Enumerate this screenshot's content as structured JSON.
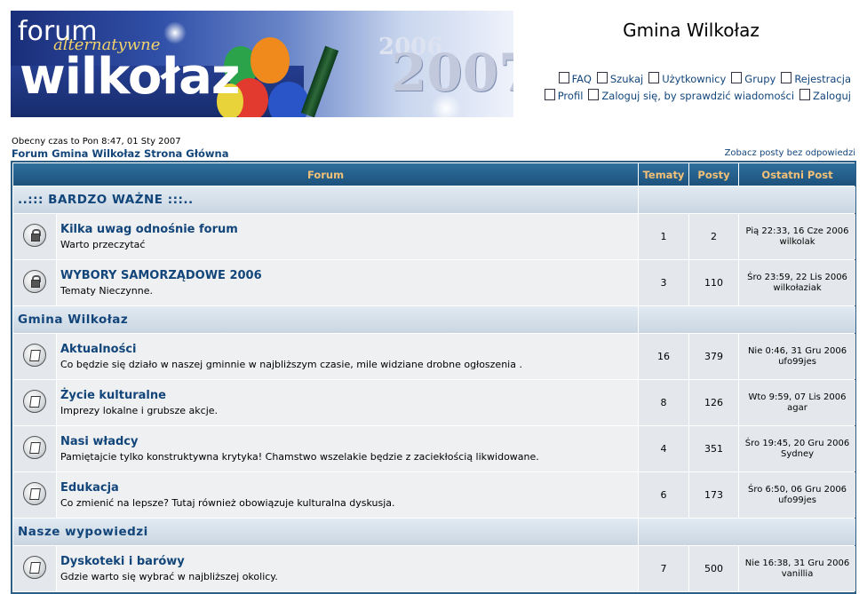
{
  "banner": {
    "forum": "forum",
    "alternatywne": "alternatywne",
    "wilkolaz": "wilkołaz",
    "year_small": "2006",
    "year_big": "2007"
  },
  "site_title": "Gmina Wilkołaz",
  "nav": {
    "row1": [
      {
        "label": "FAQ",
        "icon": "faq-icon"
      },
      {
        "label": "Szukaj",
        "icon": "search-icon"
      },
      {
        "label": "Użytkownicy",
        "icon": "members-icon"
      },
      {
        "label": "Grupy",
        "icon": "groups-icon"
      },
      {
        "label": "Rejestracja",
        "icon": "register-icon"
      }
    ],
    "row2": [
      {
        "label": "Profil",
        "icon": "profile-icon"
      },
      {
        "label": "Zaloguj się, by sprawdzić wiadomości",
        "icon": "messages-icon"
      },
      {
        "label": "Zaloguj",
        "icon": "login-icon"
      }
    ]
  },
  "current_time": "Obecny czas to Pon 8:47, 01 Sty 2007",
  "breadcrumb": "Forum Gmina Wilkołaz Strona Główna",
  "unanswered_link": "Zobacz posty bez odpowiedzi",
  "table": {
    "headers": {
      "forum": "Forum",
      "topics": "Tematy",
      "posts": "Posty",
      "last_post": "Ostatni Post"
    },
    "categories": [
      {
        "name": "..::: BARDZO WAŻNE :::..",
        "forums": [
          {
            "name": "Kilka uwag odnośnie forum",
            "desc": "Warto przeczytać",
            "topics": "1",
            "posts": "2",
            "last_date": "Pią 22:33, 16 Cze 2006",
            "last_user": "wilkolak",
            "locked": true
          },
          {
            "name": "WYBORY SAMORZĄDOWE 2006",
            "desc": "Tematy Nieczynne.",
            "topics": "3",
            "posts": "110",
            "last_date": "Śro 23:59, 22 Lis 2006",
            "last_user": "wilkołaziak",
            "locked": true
          }
        ]
      },
      {
        "name": "Gmina Wilkołaz",
        "forums": [
          {
            "name": "Aktualności",
            "desc": "Co będzie się działo w naszej gminnie w najbliższym czasie, mile widziane drobne ogłoszenia .",
            "topics": "16",
            "posts": "379",
            "last_date": "Nie 0:46, 31 Gru 2006",
            "last_user": "ufo99jes",
            "locked": false
          },
          {
            "name": "Życie kulturalne",
            "desc": "Imprezy lokalne i grubsze akcje.",
            "topics": "8",
            "posts": "126",
            "last_date": "Wto 9:59, 07 Lis 2006",
            "last_user": "agar",
            "locked": false
          },
          {
            "name": "Nasi władcy",
            "desc": "Pamiętajcie tylko konstruktywna krytyka! Chamstwo wszelakie będzie z zaciekłością likwidowane.",
            "topics": "4",
            "posts": "351",
            "last_date": "Śro 19:45, 20 Gru 2006",
            "last_user": "Sydney",
            "locked": false
          },
          {
            "name": "Edukacja",
            "desc": "Co zmienić na lepsze? Tutaj również obowiązuje kulturalna dyskusja.",
            "topics": "6",
            "posts": "173",
            "last_date": "Śro 6:50, 06 Gru 2006",
            "last_user": "ufo99jes",
            "locked": false
          }
        ]
      },
      {
        "name": "Nasze wypowiedzi",
        "forums": [
          {
            "name": "Dyskoteki i barówy",
            "desc": "Gdzie warto się wybrać w najbliższej okolicy.",
            "topics": "7",
            "posts": "500",
            "last_date": "Nie 16:38, 31 Gru 2006",
            "last_user": "vanillia",
            "locked": false
          }
        ]
      }
    ]
  }
}
